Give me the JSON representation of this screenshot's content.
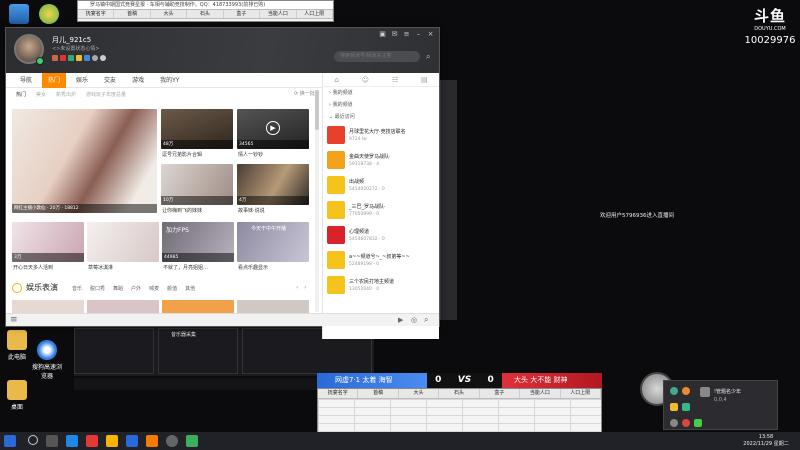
{
  "watermark": {
    "brand": "斗鱼",
    "domain": "DOUYU.COM",
    "room_id": "10029976"
  },
  "spreadsheet_top": {
    "title": "罗马镇中期国式竞赛星报 · 车相与辅助竞技制作。QQ：418733993(前排已购)",
    "headers": [
      "抚宴名字",
      "首稿",
      "大头",
      "石头",
      "盒子",
      "当能人口",
      "人口上限"
    ]
  },
  "spreadsheet_bottom": {
    "headers": [
      "抚宴名字",
      "首稿",
      "大头",
      "石头",
      "盒子",
      "当能人口",
      "人口上限"
    ]
  },
  "yy_window": {
    "user": {
      "name": "月儿_921c5",
      "signature": "<>未设置状态心情>"
    },
    "search_placeholder": "搜索频道号/频道关注量",
    "tabs": [
      "导航",
      "热门",
      "娱乐",
      "交友",
      "游戏",
      "我的YY"
    ],
    "subtabs": [
      "热门",
      "美女",
      "新秀出炉",
      "游戏玩子年度总量"
    ],
    "refresh_label": "换一批",
    "tiles": [
      {
        "caption": "网红主播小歌仙",
        "viewers": "20万",
        "likes": "18812"
      },
      {
        "caption": "逗号兄弟影片合辑",
        "viewers": "48万",
        "likes": ""
      },
      {
        "caption": "情人一钞钞",
        "viewers": "34565",
        "likes": ""
      },
      {
        "caption": "让你嗨到飞的妹妹",
        "viewers": "10万",
        "likes": ""
      },
      {
        "caption": "故事妹·说说",
        "viewers": "4万",
        "likes": ""
      },
      {
        "caption": "开心日天多人活到",
        "viewers": "3万",
        "likes": ""
      },
      {
        "caption": "草莓冰淇淋",
        "viewers": "",
        "likes": ""
      },
      {
        "caption": "不就了，月亮姐姐…",
        "viewers": "44985",
        "likes": ""
      },
      {
        "caption": "看点乐趣显示",
        "viewers": "",
        "likes": ""
      }
    ],
    "tile_overlay_texts": [
      "加力FPS",
      "今天干中午开播"
    ],
    "section_title": "娱乐表演",
    "section_tabs": [
      "音乐",
      "脱口秀",
      "舞蹈",
      "户外",
      "喊麦",
      "颜值",
      "其他"
    ],
    "right_panel": {
      "sections": [
        "我的频道",
        "我的频道",
        "最近访问"
      ],
      "contacts": [
        {
          "name": "月球里花大厅·竞技店联名",
          "info": "9724 lw"
        },
        {
          "name": "金曲天使罗马战队·",
          "info": "59318738 · 4"
        },
        {
          "name": "出战频",
          "info": "5454020272 · 0"
        },
        {
          "name": "_三巴_罗马战队·",
          "info": "77050999 · 0"
        },
        {
          "name": "心理频道",
          "info": "5454607832 · 0"
        },
        {
          "name": "a~~频道兮~_~叔弟等~~",
          "info": "52489198 · 0"
        },
        {
          "name": "三个农民打地主频道",
          "info": "13051040 · 0"
        }
      ]
    }
  },
  "desktop_icons": [
    {
      "label": "此电脑"
    },
    {
      "label": "搜狗高速浏览器"
    },
    {
      "label": "桌面"
    }
  ],
  "obs": {
    "scene_label": "昔乐器采集"
  },
  "right_text": "欢迎用户5796936进入直播间",
  "vs_bar": {
    "left_team": "网虚7·1 太着 海智",
    "left_score": "0",
    "vs": "VS",
    "right_score": "0",
    "right_team": "大头 大不能 财神"
  },
  "notify_popup": {
    "title": "!管题名少年",
    "sub": "0,0,4"
  },
  "clock": {
    "time": "13:58",
    "date": "2022/11/29 星期二"
  }
}
